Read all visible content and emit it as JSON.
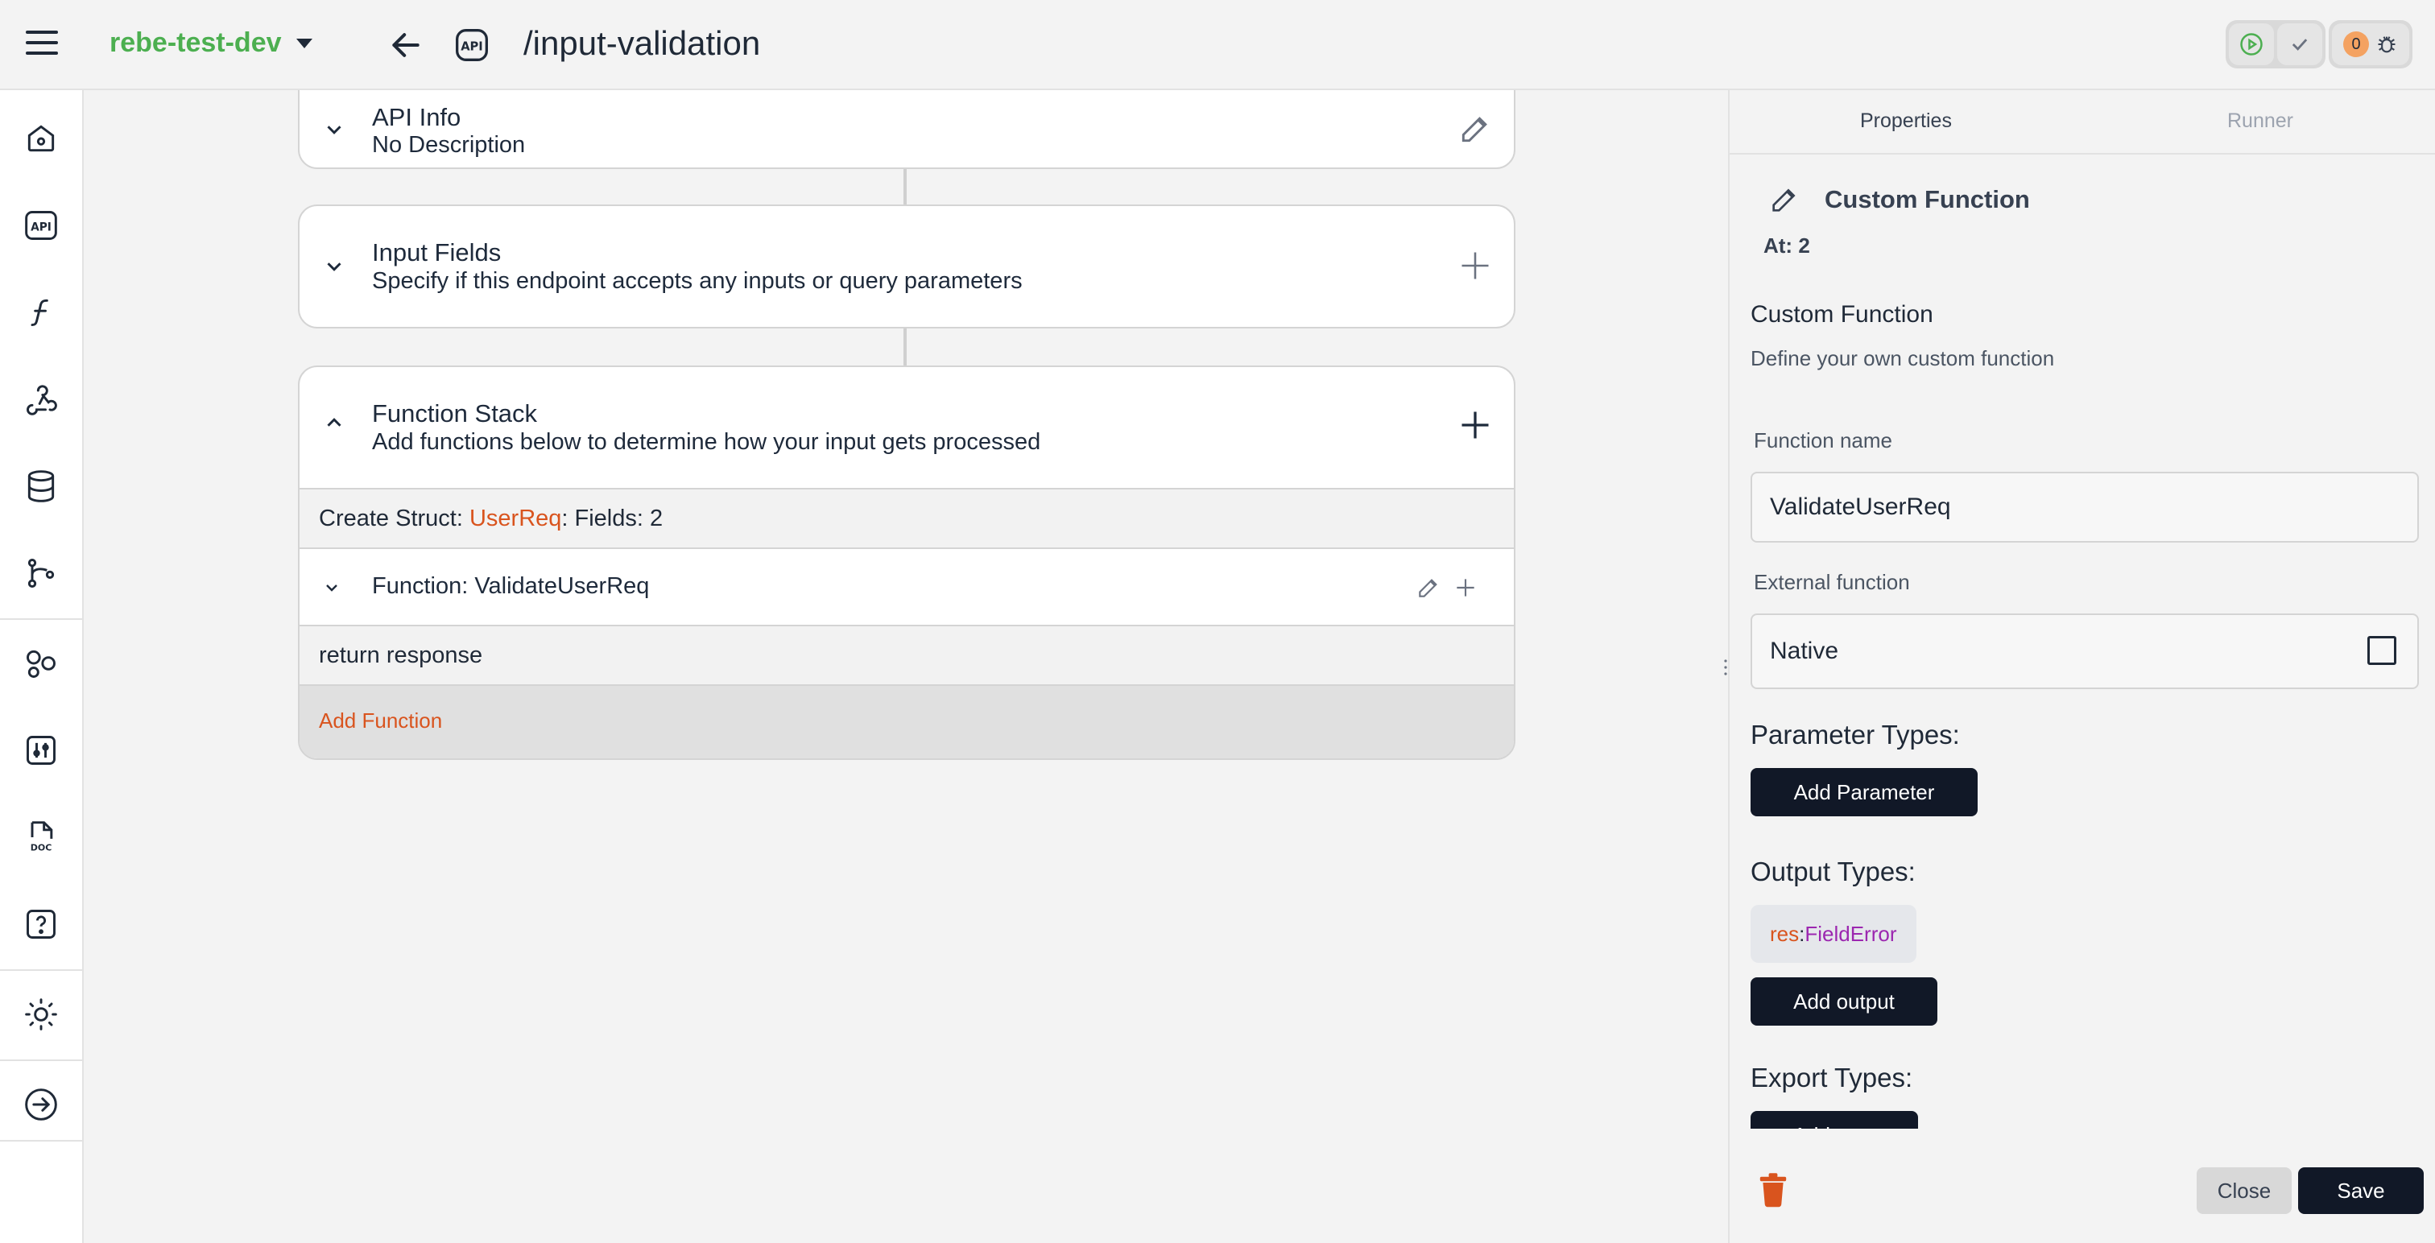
{
  "header": {
    "project_name": "rebe-test-dev",
    "route_title": "/input-validation",
    "api_badge": "API",
    "error_count": "0"
  },
  "sidebar": {
    "items": [
      {
        "icon": "home-icon"
      },
      {
        "icon": "api-icon"
      },
      {
        "icon": "function-icon"
      },
      {
        "icon": "webhook-icon"
      },
      {
        "icon": "database-icon"
      },
      {
        "icon": "git-branch-icon"
      },
      {
        "icon": "shapes-icon"
      },
      {
        "icon": "settings-icon"
      },
      {
        "icon": "doc-icon"
      },
      {
        "icon": "help-icon"
      },
      {
        "icon": "theme-icon"
      },
      {
        "icon": "logout-icon"
      }
    ]
  },
  "cards": {
    "api_info": {
      "title": "API Info",
      "subtitle": "No Description"
    },
    "input_fields": {
      "title": "Input Fields",
      "subtitle": "Specify if this endpoint accepts any inputs or query parameters"
    },
    "function_stack": {
      "title": "Function Stack",
      "subtitle": "Add functions below to determine how your input gets processed",
      "rows": {
        "create_struct_prefix": "Create Struct: ",
        "create_struct_name": "UserReq",
        "create_struct_suffix": ": Fields: 2",
        "function_label": "Function: ValidateUserReq",
        "return_label": "return response",
        "add_function": "Add Function"
      }
    }
  },
  "panel": {
    "tabs": [
      "Properties",
      "Runner"
    ],
    "title": "Custom Function",
    "at": "At: 2",
    "section_title": "Custom Function",
    "section_desc": "Define your own custom function",
    "function_name_label": "Function name",
    "function_name_value": "ValidateUserReq",
    "external_function_label": "External function",
    "external_function_value": "Native",
    "parameter_types_label": "Parameter Types:",
    "add_parameter": "Add Parameter",
    "output_types_label": "Output Types:",
    "output_name": "res",
    "output_sep": ": ",
    "output_type": "FieldError",
    "add_output": "Add output",
    "export_types_label": "Export Types:",
    "add_type": "Add type",
    "close": "Close",
    "save": "Save"
  },
  "colors": {
    "project_green": "#4caf50",
    "accent_orange": "#d9541e",
    "type_purple": "#9c27b0",
    "dark_button": "#111827"
  }
}
